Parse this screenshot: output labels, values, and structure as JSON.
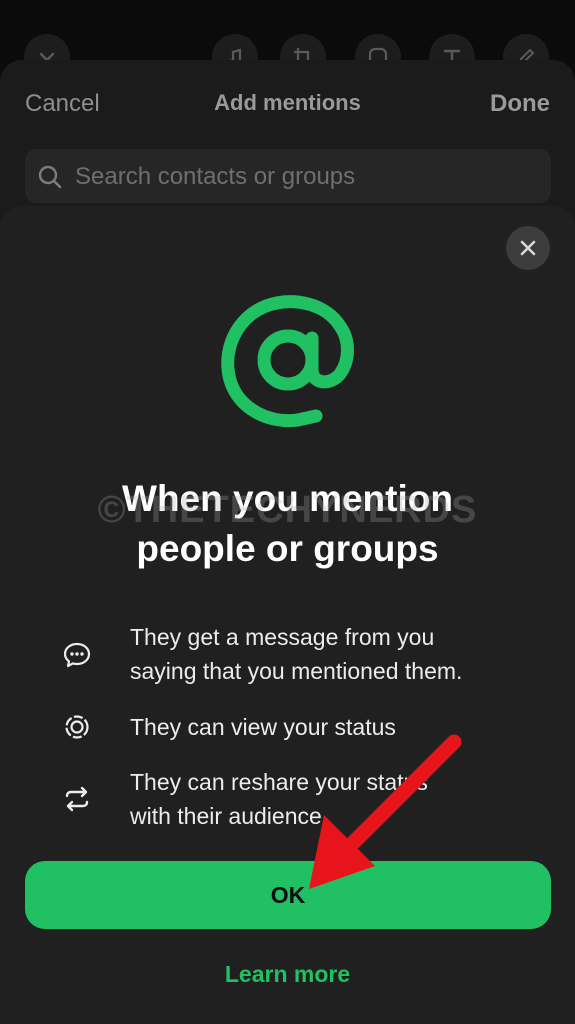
{
  "editor_toolbar": {
    "tools": [
      "chevron-down-icon",
      "music-icon",
      "crop-rotate-icon",
      "sticker-icon",
      "text-icon",
      "pencil-icon"
    ]
  },
  "mentions_sheet": {
    "cancel_label": "Cancel",
    "title": "Add mentions",
    "done_label": "Done",
    "search": {
      "placeholder": "Search contacts or groups",
      "value": ""
    }
  },
  "info_modal": {
    "close_icon": "close-icon",
    "hero_icon": "at-sign-icon",
    "title_line1": "When you mention",
    "title_line2": "people or groups",
    "watermark": "©THETECHYNERDS",
    "items": [
      {
        "icon": "message-icon",
        "line1": "They get a message from you",
        "line2": "saying that you mentioned them."
      },
      {
        "icon": "status-icon",
        "line1": "They can view your status",
        "line2": ""
      },
      {
        "icon": "reshare-icon",
        "line1": "They can reshare your status",
        "line2": "with their audience."
      }
    ],
    "ok_label": "OK",
    "learn_more_label": "Learn more"
  },
  "colors": {
    "accent_green": "#21c063",
    "annotation_red": "#e8141b",
    "sheet_background": "#1f201f"
  }
}
